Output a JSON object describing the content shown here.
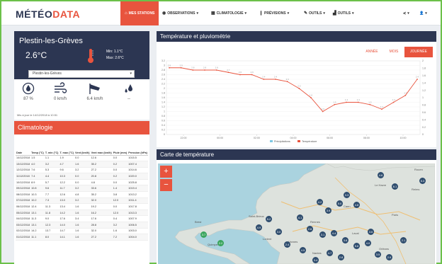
{
  "brand": {
    "part1": "MÉTÉO",
    "part2": "DATA"
  },
  "nav": {
    "items": [
      {
        "label": "MES STATIONS",
        "icon": "home-icon"
      },
      {
        "label": "OBSERVATIONS",
        "icon": "eye-icon"
      },
      {
        "label": "CLIMATOLOGIE",
        "icon": "table-icon"
      },
      {
        "label": "PRÉVISIONS",
        "icon": "thermometer-icon"
      },
      {
        "label": "OUTILS",
        "icon": "wrench-icon"
      },
      {
        "label": "OUTILS",
        "icon": "chart-icon"
      }
    ],
    "share_icon": "share-icon",
    "user_icon": "user-icon"
  },
  "station": {
    "name": "Plestin-les-Grèves",
    "temp": "2.6°C",
    "min": "Min: 1.1°C",
    "max": "Max: 2.6°C",
    "select_value": "Plestin-les-Grèves",
    "humidity": "87 %",
    "wind": "0 km/h",
    "gust": "6.4 km/h",
    "rain": "--",
    "updated": "Mis à jour le 14/12/2018 à 10:51"
  },
  "climatologie": {
    "title": "Climatologie",
    "headers": [
      "Date",
      "Temp (°C)",
      "T. min (°C)",
      "T. max (°C)",
      "Vent (km/h)",
      "Vent max (km/h)",
      "Pluie (mm)",
      "Pression (hPa)"
    ],
    "rows": [
      [
        "14/12/2018",
        "1.5",
        "1.1",
        "1.9",
        "0.0",
        "12.6",
        "0.0",
        "1015.5"
      ],
      [
        "13/12/2018",
        "4.0",
        "3.2",
        "4.7",
        "1.6",
        "35.2",
        "0.2",
        "1007.4"
      ],
      [
        "12/12/2018",
        "7.6",
        "5.3",
        "9.6",
        "3.2",
        "27.2",
        "0.0",
        "1014.6"
      ],
      [
        "11/12/2018",
        "7.4",
        "4.4",
        "10.3",
        "0.0",
        "20.8",
        "0.2",
        "1020.0"
      ],
      [
        "10/12/2018",
        "8.9",
        "5.7",
        "12.2",
        "0.0",
        "4.8",
        "0.0",
        "1025.8"
      ],
      [
        "09/12/2018",
        "10.8",
        "9.6",
        "11.7",
        "3.2",
        "33.6",
        "1.4",
        "1019.4"
      ],
      [
        "08/12/2018",
        "10.3",
        "7.7",
        "12.6",
        "4.8",
        "35.2",
        "3.8",
        "1013.2"
      ],
      [
        "07/12/2018",
        "10.2",
        "7.3",
        "13.0",
        "3.2",
        "32.0",
        "12.0",
        "1011.4"
      ],
      [
        "06/12/2018",
        "12.4",
        "11.3",
        "13.4",
        "1.6",
        "19.2",
        "0.0",
        "1017.8"
      ],
      [
        "05/12/2018",
        "13.1",
        "11.8",
        "14.2",
        "1.6",
        "16.2",
        "12.0",
        "1013.3"
      ],
      [
        "04/12/2018",
        "11.3",
        "9.0",
        "17.6",
        "3.4",
        "17.6",
        "0.4",
        "1007.9"
      ],
      [
        "03/12/2018",
        "13.1",
        "12.3",
        "14.0",
        "1.6",
        "28.8",
        "3.2",
        "1006.5"
      ],
      [
        "02/12/2018",
        "14.2",
        "13.7",
        "14.7",
        "1.6",
        "32.0",
        "1.6",
        "1003.0"
      ],
      [
        "01/12/2018",
        "11.1",
        "8.0",
        "14.1",
        "1.6",
        "27.2",
        "7.2",
        "1004.0"
      ]
    ]
  },
  "chart_panel": {
    "title": "Température et pluviométrie",
    "buttons": [
      "ANNÉE",
      "MOIS",
      "JOURNÉE"
    ],
    "active": "JOURNÉE"
  },
  "chart_data": {
    "type": "line",
    "x": [
      "22:00",
      "00:00",
      "02:00",
      "04:00",
      "06:00",
      "08:00",
      "10:00"
    ],
    "left_ticks": [
      "3.2",
      "3",
      "2.8",
      "2.6",
      "2.4",
      "2.2",
      "2",
      "1.8",
      "1.6",
      "1.4",
      "1.2",
      "1",
      "0.8",
      "0.6",
      "0.4",
      "0.2",
      "0"
    ],
    "right_ticks": [
      "2",
      "1.8",
      "1.6",
      "1.4",
      "1.2",
      "1",
      "0.8",
      "0.6",
      "0.4",
      "0.2",
      "0"
    ],
    "series": [
      {
        "name": "Température",
        "color": "#e8543e",
        "values": [
          2.9,
          2.9,
          2.8,
          2.8,
          2.8,
          2.7,
          2.6,
          2.6,
          2.4,
          2.4,
          2.3,
          2.0,
          1.6,
          1.0,
          1.3,
          1.4,
          1.4,
          1.3,
          1.1,
          1.4,
          1.7,
          2.4
        ]
      },
      {
        "name": "Précipitations",
        "color": "#7ec8e3",
        "values": []
      }
    ],
    "ylim": [
      0,
      3.2
    ],
    "y2lim": [
      0,
      2
    ],
    "legend": "bottom"
  },
  "map_panel": {
    "title": "Carte de température",
    "zoom_in": "+",
    "zoom_out": "−",
    "cities": [
      "Rouen",
      "Caen",
      "Rennes",
      "Nantes",
      "Laval",
      "Vannes",
      "Lorient",
      "Saint-Brieuc",
      "Brest",
      "Quimper",
      "Le Havre",
      "Paris",
      "Reims",
      "Orléans"
    ],
    "markers": [
      "5.3",
      "4.6",
      "6.1",
      "4.2",
      "3.9",
      "5.0",
      "3.3",
      "4.8",
      "2.6",
      "3.1",
      "4.4",
      "3.8",
      "5.6",
      "4.0",
      "3.5",
      "2.9",
      "4.1",
      "3.7",
      "2.2",
      "4.9",
      "5.2",
      "3.0",
      "2.4",
      "4.5",
      "3.4",
      "4.7",
      "2.8",
      "3.6",
      "2.1"
    ]
  }
}
